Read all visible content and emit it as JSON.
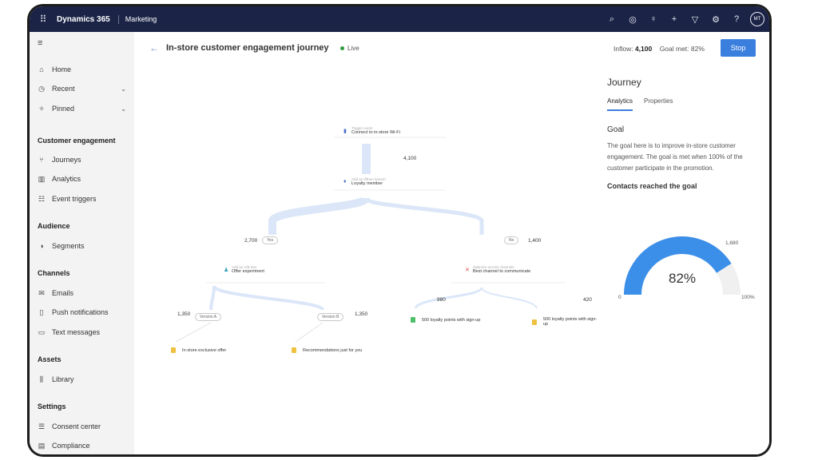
{
  "app": {
    "name": "Dynamics 365",
    "module": "Marketing",
    "avatar_initials": "MT"
  },
  "topbar_icons": [
    "search-icon",
    "target-icon",
    "lightbulb-icon",
    "plus-icon",
    "filter-icon",
    "gear-icon",
    "help-icon"
  ],
  "sidebar": {
    "items": [
      {
        "label": "Home",
        "icon": "home-icon"
      },
      {
        "label": "Recent",
        "icon": "clock-icon"
      },
      {
        "label": "Pinned",
        "icon": "pin-icon"
      }
    ],
    "sections": [
      {
        "title": "Customer engagement",
        "items": [
          {
            "label": "Journeys"
          },
          {
            "label": "Analytics"
          },
          {
            "label": "Event triggers"
          }
        ]
      },
      {
        "title": "Audience",
        "items": [
          {
            "label": "Segments"
          }
        ]
      },
      {
        "title": "Channels",
        "items": [
          {
            "label": "Emails"
          },
          {
            "label": "Push notifications"
          },
          {
            "label": "Text messages"
          }
        ]
      },
      {
        "title": "Assets",
        "items": [
          {
            "label": "Library"
          }
        ]
      },
      {
        "title": "Settings",
        "items": [
          {
            "label": "Consent center"
          },
          {
            "label": "Compliance"
          }
        ]
      }
    ]
  },
  "header": {
    "title": "In-store customer engagement journey",
    "status": "Live",
    "inflow_label": "Inflow:",
    "inflow_value": "4,100",
    "goal_label": "Goal met:",
    "goal_value": "82%",
    "stop_label": "Stop"
  },
  "journey": {
    "trigger": {
      "caption": "Trigger event",
      "label": "Connect to in-store Wi-Fi"
    },
    "trigger_count": "4,100",
    "branch": {
      "caption": "Add an if/then branch",
      "label": "Loyalty member"
    },
    "yes_label": "Yes",
    "no_label": "No",
    "yes_count": "2,700",
    "no_count": "1,400",
    "experiment": {
      "caption": "Add an A/B test",
      "label": "Offer experiment"
    },
    "best_channel": {
      "caption": "Optimize across channels",
      "label": "Best channel to communicate"
    },
    "version_a": "Version A",
    "version_b": "Version B",
    "version_a_count": "1,350",
    "version_b_count": "1,350",
    "channel_left_count": "980",
    "channel_right_count": "420",
    "leaf_points_1": "500 loyalty points with sign-up",
    "leaf_points_2": "500 loyalty points with sign-up",
    "leaf_offer": "In-store exclusive offer",
    "leaf_recommend": "Recommendations just for you"
  },
  "panel": {
    "title": "Journey",
    "tab_analytics": "Analytics",
    "tab_properties": "Properties",
    "goal_heading": "Goal",
    "goal_text": "The goal here is to improve in-store customer engagement. The goal is met when 100% of the customer participate in the promotion.",
    "contacts_heading": "Contacts reached the goal",
    "gauge": {
      "value_pct": 82,
      "center_label": "82%",
      "min_label": "0",
      "max_label": "100%",
      "target_label": "1,680",
      "fill_color": "#3b8fe8",
      "track_color": "#f0f0f0"
    }
  }
}
